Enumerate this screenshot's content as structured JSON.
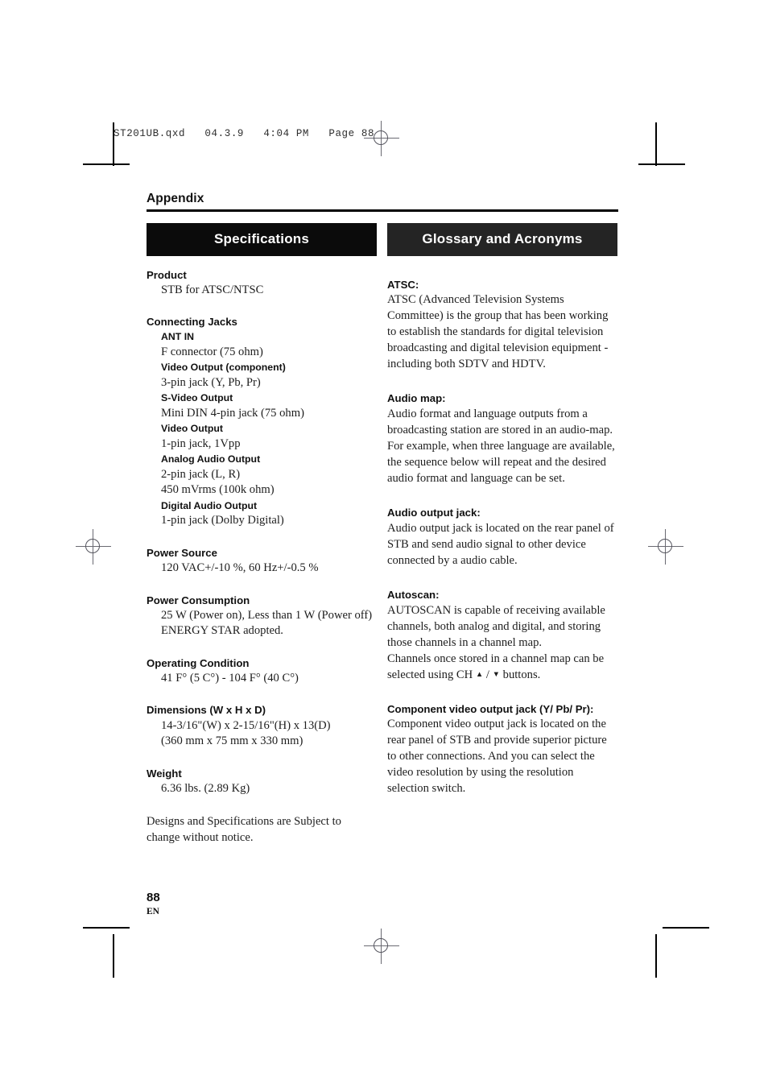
{
  "slug_line": "ST201UB.qxd   04.3.9   4:04 PM   Page 88",
  "header": {
    "appendix_label": "Appendix"
  },
  "left_column": {
    "section_title": "Specifications",
    "groups": [
      {
        "heading": "Product",
        "lines": [
          "STB for ATSC/NTSC"
        ]
      },
      {
        "heading": "Connecting Jacks",
        "subitems": [
          {
            "label": "ANT IN",
            "lines": [
              "F connector (75 ohm)"
            ]
          },
          {
            "label": "Video Output (component)",
            "lines": [
              "3-pin jack (Y, Pb, Pr)"
            ]
          },
          {
            "label": "S-Video Output",
            "lines": [
              "Mini DIN 4-pin jack (75 ohm)"
            ]
          },
          {
            "label": "Video Output",
            "lines": [
              "1-pin jack, 1Vpp"
            ]
          },
          {
            "label": "Analog Audio Output",
            "lines": [
              "2-pin jack (L, R)",
              "450 mVrms (100k ohm)"
            ]
          },
          {
            "label": "Digital Audio Output",
            "lines": [
              "1-pin jack (Dolby Digital)"
            ]
          }
        ]
      },
      {
        "heading": "Power Source",
        "lines": [
          "120 VAC+/-10 %, 60 Hz+/-0.5 %"
        ]
      },
      {
        "heading": "Power Consumption",
        "lines": [
          "25 W (Power on), Less than 1 W (Power off)",
          "ENERGY STAR adopted."
        ]
      },
      {
        "heading": "Operating Condition",
        "lines": [
          "41 F° (5 C°) - 104 F° (40 C°)"
        ]
      },
      {
        "heading": "Dimensions (W x H x D)",
        "lines": [
          "14-3/16\"(W) x 2-15/16\"(H) x 13(D)",
          "(360 mm x 75 mm x 330 mm)"
        ]
      },
      {
        "heading": "Weight",
        "lines": [
          "6.36 lbs. (2.89 Kg)"
        ]
      }
    ],
    "closing_note": "Designs and Specifications are Subject to change without notice."
  },
  "right_column": {
    "section_title": "Glossary and Acronyms",
    "entries": [
      {
        "term": "ATSC:",
        "paragraphs": [
          "ATSC (Advanced Television Systems Committee) is the group that has been working to establish the standards for digital television broadcasting and digital television equipment - including both SDTV and HDTV."
        ]
      },
      {
        "term": "Audio map:",
        "paragraphs": [
          "Audio format and language outputs from a broadcasting station are stored in an audio-map.",
          "For example, when three language are available, the sequence below will repeat and the desired audio format and language can be set."
        ]
      },
      {
        "term": "Audio output jack:",
        "paragraphs": [
          "Audio output jack is located on the rear panel of STB and send audio signal to other device connected by a audio cable."
        ]
      },
      {
        "term": "Autoscan:",
        "paragraphs": [
          "AUTOSCAN is capable of receiving available channels, both analog and digital, and storing those channels in a channel map."
        ],
        "paragraph_with_arrows": {
          "before": "Channels once stored in a channel map can be selected using CH ",
          "middle": " / ",
          "after": " buttons."
        }
      },
      {
        "term": "Component video output jack (Y/ Pb/ Pr):",
        "paragraphs": [
          "Component video output jack is located on the rear panel of STB and provide superior picture to other connections. And you can select the video resolution by using the resolution selection switch."
        ]
      }
    ]
  },
  "footer": {
    "page_number": "88",
    "language_code": "EN"
  }
}
